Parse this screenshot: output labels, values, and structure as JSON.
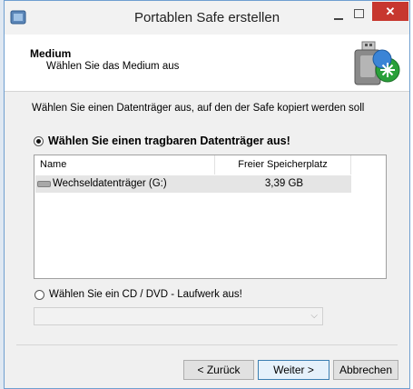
{
  "window": {
    "title": "Portablen Safe erstellen",
    "close_glyph": "✕"
  },
  "header": {
    "title": "Medium",
    "subtitle": "Wählen Sie das Medium aus",
    "icon": "usb-drive-with-star-icon"
  },
  "instruction": "Wählen Sie einen Datenträger aus, auf den der Safe kopiert werden soll",
  "option_removable": {
    "label": "Wählen Sie einen tragbaren Datenträger aus!",
    "selected": true
  },
  "drive_list": {
    "columns": [
      "Name",
      "Freier Speicherplatz"
    ],
    "rows": [
      {
        "name": "Wechseldatenträger (G:)",
        "free": "3,39 GB",
        "icon": "removable-drive-icon"
      }
    ]
  },
  "option_cd": {
    "label": "Wählen Sie ein CD / DVD - Laufwerk aus!",
    "selected": false
  },
  "cd_combo": {
    "value": "",
    "arrow": "⌵"
  },
  "buttons": {
    "back": "< Zurück",
    "next": "Weiter >",
    "cancel": "Abbrechen"
  }
}
